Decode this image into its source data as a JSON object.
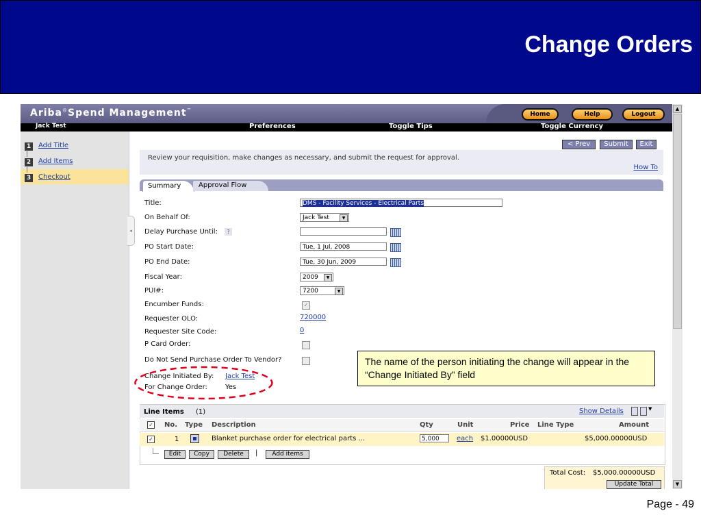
{
  "slide": {
    "title": "Change Orders",
    "page": "Page - 49"
  },
  "app": {
    "brand": "Ariba",
    "brand_reg": "®",
    "brand_rest": "Spend Management",
    "brand_tm": "™",
    "top_buttons": {
      "home": "Home",
      "help": "Help",
      "logout": "Logout"
    },
    "user": "Jack Test",
    "menu": {
      "preferences": "Preferences",
      "tips": "Toggle Tips",
      "currency": "Toggle Currency"
    }
  },
  "steps": [
    {
      "num": "1",
      "label": "Add Title"
    },
    {
      "num": "2",
      "label": "Add Items"
    },
    {
      "num": "3",
      "label": "Checkout"
    }
  ],
  "nav_buttons": {
    "prev": "< Prev",
    "submit": "Submit",
    "exit": "Exit"
  },
  "instructions": "Review your requisition, make changes as necessary, and submit the request for approval.",
  "how_to": "How To",
  "tabs": {
    "summary": "Summary",
    "approval": "Approval Flow"
  },
  "form": {
    "title_label": "Title:",
    "title_value": "DMS - Facility Services - Electrical Parts",
    "behalf_label": "On Behalf Of:",
    "behalf_value": "Jack Test",
    "delay_label": "Delay Purchase Until:",
    "delay_help": "?",
    "delay_value": "",
    "po_start_label": "PO Start Date:",
    "po_start_value": "Tue, 1 Jul, 2008",
    "po_end_label": "PO End Date:",
    "po_end_value": "Tue, 30 Jun, 2009",
    "fiscal_label": "Fiscal Year:",
    "fiscal_value": "2009",
    "pui_label": "PUI#:",
    "pui_value": "7200",
    "encumber_label": "Encumber Funds:",
    "olo_label": "Requester OLO:",
    "olo_value": "720000",
    "site_label": "Requester Site Code:",
    "site_value": "0",
    "pcard_label": "P Card Order:",
    "nosend_label": "Do Not Send Purchase Order To Vendor?",
    "change_by_label": "Change Initiated By:",
    "change_by_value": "Jack Test",
    "for_change_label": "For Change Order:",
    "for_change_value": "Yes"
  },
  "line_items": {
    "title": "Line Items",
    "count": "(1)",
    "show_details": "Show Details",
    "columns": {
      "no": "No.",
      "type": "Type",
      "desc": "Description",
      "qty": "Qty",
      "unit": "Unit",
      "price": "Price",
      "line_type": "Line Type",
      "amount": "Amount"
    },
    "rows": [
      {
        "no": "1",
        "desc": "Blanket purchase order for electrical parts ...",
        "qty": "5,000",
        "unit": "each",
        "price": "$1.00000USD",
        "amount": "$5,000.00000USD"
      }
    ],
    "actions": {
      "edit": "Edit",
      "copy": "Copy",
      "delete": "Delete",
      "sep": "|",
      "add": "Add items"
    },
    "total_label": "Total Cost:",
    "total_value": "$5,000.00000USD",
    "update_label": "Update Total"
  },
  "callout": "The name of the person initiating the change will appear in the “Change Initiated By” field",
  "colors": {
    "slide_bg": "#00098c",
    "callout_bg": "#ffffcc",
    "ellipse": "#e0001b",
    "accent": "#7d7fad"
  }
}
